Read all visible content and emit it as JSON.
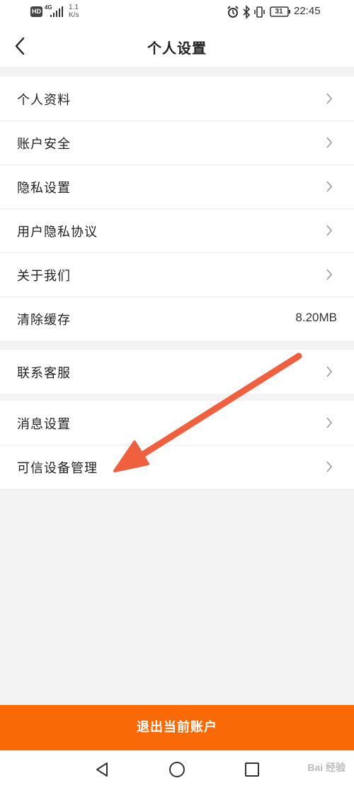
{
  "status_bar": {
    "hd_badge": "HD",
    "net_type": "4G",
    "speed_value": "1.1",
    "speed_unit": "K/s",
    "battery_level": "31",
    "time": "22:45",
    "icons": [
      "signal-icon",
      "alarm-icon",
      "bluetooth-icon",
      "vibrate-icon",
      "battery-icon"
    ]
  },
  "header": {
    "title": "个人设置",
    "back_icon": "chevron-left-icon"
  },
  "groups": [
    {
      "items": [
        {
          "label": "个人资料"
        },
        {
          "label": "账户安全"
        },
        {
          "label": "隐私设置"
        },
        {
          "label": "用户隐私协议"
        },
        {
          "label": "关于我们"
        },
        {
          "label": "清除缓存",
          "value": "8.20MB"
        }
      ]
    },
    {
      "items": [
        {
          "label": "联系客服"
        }
      ]
    },
    {
      "items": [
        {
          "label": "消息设置"
        },
        {
          "label": "可信设备管理"
        }
      ]
    }
  ],
  "logout_button": "退出当前账户",
  "nav_bar": {
    "icons": [
      "nav-back-icon",
      "nav-home-icon",
      "nav-recent-icon"
    ],
    "watermark": "Bai 经验"
  },
  "colors": {
    "accent": "#f96a06",
    "annotation_arrow": "#f0603e",
    "background": "#f3f3f3"
  }
}
